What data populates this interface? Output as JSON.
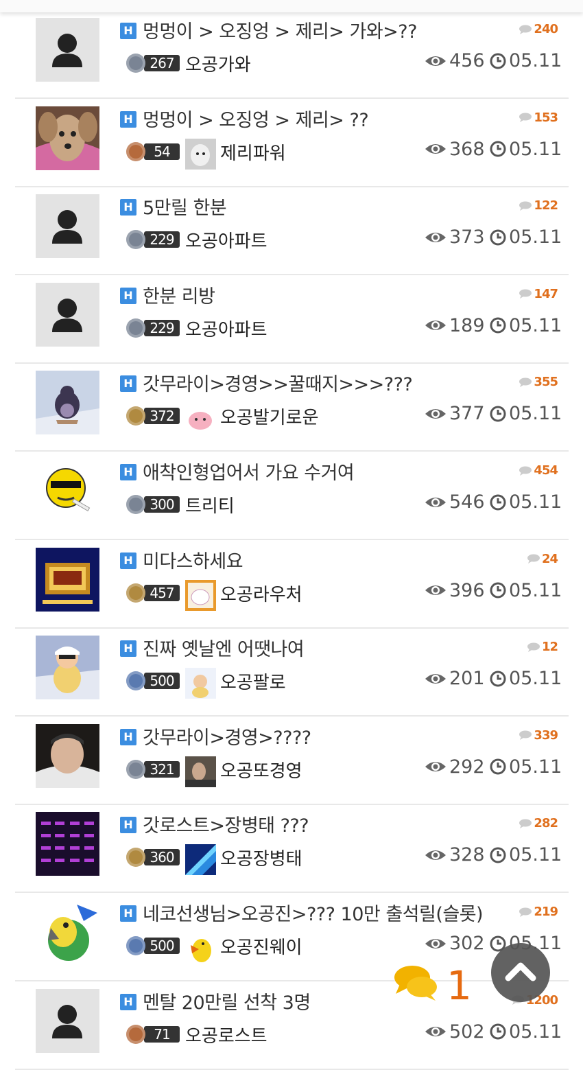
{
  "posts": [
    {
      "title": "멍멍이 > 오징엉 > 제리> 가와>??",
      "comments": "240",
      "level": "267",
      "nick": "오공가와",
      "views": "456",
      "date": "05.11",
      "has_avatar": false,
      "thumb": "placeholder"
    },
    {
      "title": "멍멍이 > 오징엉 > 제리> ??",
      "comments": "153",
      "level": "54",
      "nick": "제리파워",
      "views": "368",
      "date": "05.11",
      "has_avatar": true,
      "thumb": "dog"
    },
    {
      "title": "5만릴 한분",
      "comments": "122",
      "level": "229",
      "nick": "오공아파트",
      "views": "373",
      "date": "05.11",
      "has_avatar": false,
      "thumb": "placeholder"
    },
    {
      "title": "한분 리방",
      "comments": "147",
      "level": "229",
      "nick": "오공아파트",
      "views": "189",
      "date": "05.11",
      "has_avatar": false,
      "thumb": "placeholder"
    },
    {
      "title": "갓무라이>경영>>꿀때지>>>???",
      "comments": "355",
      "level": "372",
      "nick": "오공발기로운",
      "views": "377",
      "date": "05.11",
      "has_avatar": true,
      "thumb": "penguin"
    },
    {
      "title": "애착인형업어서 가요 수거여",
      "comments": "454",
      "level": "300",
      "nick": "트리티",
      "views": "546",
      "date": "05.11",
      "has_avatar": false,
      "thumb": "emoji"
    },
    {
      "title": "미다스하세요",
      "comments": "24",
      "level": "457",
      "nick": "오공라우처",
      "views": "396",
      "date": "05.11",
      "has_avatar": true,
      "thumb": "slot"
    },
    {
      "title": "진짜 옛날엔 어땟나여",
      "comments": "12",
      "level": "500",
      "nick": "오공팔로",
      "views": "201",
      "date": "05.11",
      "has_avatar": true,
      "thumb": "cartoon"
    },
    {
      "title": "갓무라이>경영>????",
      "comments": "339",
      "level": "321",
      "nick": "오공또경영",
      "views": "292",
      "date": "05.11",
      "has_avatar": true,
      "thumb": "man"
    },
    {
      "title": "갓로스트>장병태 ???",
      "comments": "282",
      "level": "360",
      "nick": "오공장병태",
      "views": "328",
      "date": "05.11",
      "has_avatar": true,
      "thumb": "grid"
    },
    {
      "title": "네코선생님>오공진>??? 10만 출석릴(슬롯)",
      "comments": "219",
      "level": "500",
      "nick": "오공진웨이",
      "views": "302",
      "date": "05.11",
      "has_avatar": true,
      "thumb": "parrot"
    },
    {
      "title": "멘탈 20만릴 선착 3명",
      "comments": "1200",
      "level": "71",
      "nick": "오공로스트",
      "views": "502",
      "date": "05.11",
      "has_avatar": false,
      "thumb": "placeholder"
    }
  ],
  "fab": {
    "chat_count": "1"
  },
  "icons": {
    "badge": "H",
    "eye": "eye-icon",
    "clock": "clock-icon",
    "comment": "comment-bubble-icon",
    "scroll_top": "chevron-up-icon",
    "chat": "chat-bubbles-icon"
  },
  "colors": {
    "accent": "#e0701e",
    "badge": "#3b8de0",
    "chat_count": "#e66a10"
  }
}
